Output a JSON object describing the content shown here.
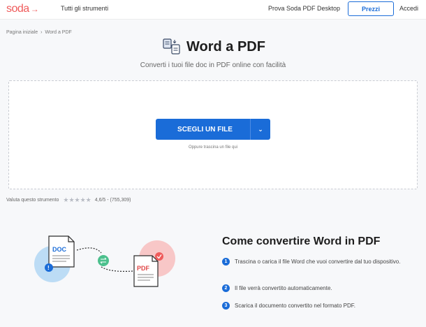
{
  "header": {
    "logo_text": "soda",
    "nav_tools": "Tutti gli strumenti",
    "nav_desktop": "Prova Soda PDF Desktop",
    "prices_button": "Prezzi",
    "login": "Accedi"
  },
  "breadcrumb": {
    "home": "Pagina iniziale",
    "separator": "›",
    "current": "Word a PDF"
  },
  "hero": {
    "title": "Word a PDF",
    "subtitle": "Converti i tuoi file doc in PDF online con facilità"
  },
  "upload": {
    "choose_button": "SCEGLI UN FILE",
    "drop_hint": "Oppure trascina un file qui"
  },
  "rating": {
    "label": "Valuta questo strumento",
    "stars": 5,
    "score": "4,6/5 - (755,309)"
  },
  "how_to": {
    "title": "Come convertire Word in PDF",
    "steps": [
      {
        "num": "1",
        "text": "Trascina o carica il file Word che vuoi convertire dal tuo dispositivo."
      },
      {
        "num": "2",
        "text": "Il file verrà convertito automaticamente."
      },
      {
        "num": "3",
        "text": "Scarica il documento convertito nel formato PDF."
      }
    ]
  },
  "illustration": {
    "doc_label": "DOC",
    "pdf_label": "PDF"
  },
  "colors": {
    "brand": "#ef5b5b",
    "accent": "#1a6cd8",
    "light_blue": "#bcdcf5",
    "light_red": "#f8c7c7",
    "green": "#4cc08d"
  }
}
